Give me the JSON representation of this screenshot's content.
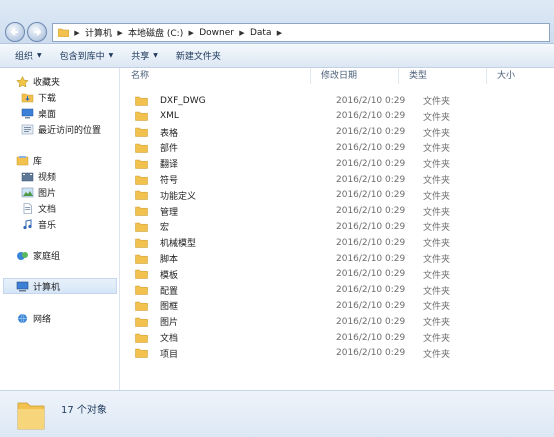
{
  "address": {
    "crumbs": [
      "计算机",
      "本地磁盘 (C:)",
      "Downer",
      "Data"
    ]
  },
  "toolbar": {
    "organize": "组织",
    "include_in_library": "包含到库中",
    "share": "共享",
    "new_folder": "新建文件夹"
  },
  "sidebar": {
    "favorites": "收藏夹",
    "downloads": "下载",
    "desktop": "桌面",
    "recent": "最近访问的位置",
    "libraries": "库",
    "videos": "视频",
    "pictures": "图片",
    "documents": "文档",
    "music": "音乐",
    "homegroup": "家庭组",
    "computer": "计算机",
    "network": "网络"
  },
  "columns": {
    "name": "名称",
    "date": "修改日期",
    "type": "类型",
    "size": "大小"
  },
  "files": [
    {
      "name": "DXF_DWG",
      "date": "2016/2/10 0:29",
      "type": "文件夹"
    },
    {
      "name": "XML",
      "date": "2016/2/10 0:29",
      "type": "文件夹"
    },
    {
      "name": "表格",
      "date": "2016/2/10 0:29",
      "type": "文件夹"
    },
    {
      "name": "部件",
      "date": "2016/2/10 0:29",
      "type": "文件夹"
    },
    {
      "name": "翻译",
      "date": "2016/2/10 0:29",
      "type": "文件夹"
    },
    {
      "name": "符号",
      "date": "2016/2/10 0:29",
      "type": "文件夹"
    },
    {
      "name": "功能定义",
      "date": "2016/2/10 0:29",
      "type": "文件夹"
    },
    {
      "name": "管理",
      "date": "2016/2/10 0:29",
      "type": "文件夹"
    },
    {
      "name": "宏",
      "date": "2016/2/10 0:29",
      "type": "文件夹"
    },
    {
      "name": "机械模型",
      "date": "2016/2/10 0:29",
      "type": "文件夹"
    },
    {
      "name": "脚本",
      "date": "2016/2/10 0:29",
      "type": "文件夹"
    },
    {
      "name": "模板",
      "date": "2016/2/10 0:29",
      "type": "文件夹"
    },
    {
      "name": "配置",
      "date": "2016/2/10 0:29",
      "type": "文件夹"
    },
    {
      "name": "图框",
      "date": "2016/2/10 0:29",
      "type": "文件夹"
    },
    {
      "name": "图片",
      "date": "2016/2/10 0:29",
      "type": "文件夹"
    },
    {
      "name": "文档",
      "date": "2016/2/10 0:29",
      "type": "文件夹"
    },
    {
      "name": "项目",
      "date": "2016/2/10 0:29",
      "type": "文件夹"
    }
  ],
  "status": {
    "count": "17 个对象"
  },
  "colors": {
    "folder": "#f2c14e",
    "accent": "#1e395b"
  }
}
